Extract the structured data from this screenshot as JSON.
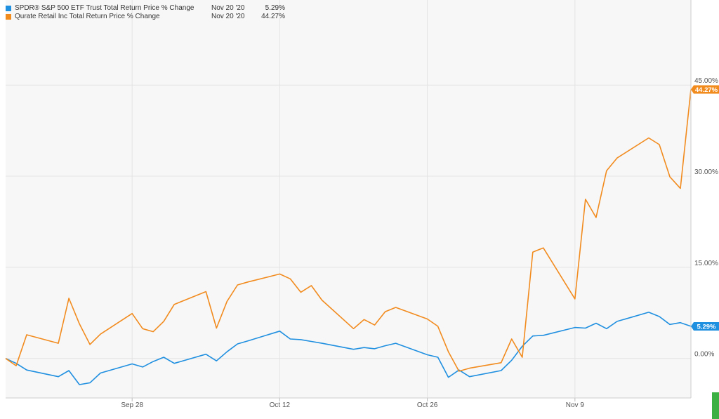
{
  "legend": [
    {
      "name": "SPDR® S&P 500 ETF Trust Total Return Price % Change",
      "date": "Nov 20 '20",
      "value": "5.29%",
      "color": "#1f8fe0"
    },
    {
      "name": "Qurate Retail Inc Total Return Price % Change",
      "date": "Nov 20 '20",
      "value": "44.27%",
      "color": "#f28b1e"
    }
  ],
  "colors": {
    "plot_background": "#f7f7f7",
    "grid": "#e4e4e4",
    "axis_text": "#555555",
    "accent_green": "#3cb043"
  },
  "chart_data": {
    "type": "line",
    "title": "",
    "xlabel": "",
    "ylabel": "",
    "ylim": [
      -6.5,
      59
    ],
    "x_ticks": [
      {
        "label": "Sep 28",
        "date": "2020-09-28"
      },
      {
        "label": "Oct 12",
        "date": "2020-10-12"
      },
      {
        "label": "Oct 26",
        "date": "2020-10-26"
      },
      {
        "label": "Nov 9",
        "date": "2020-11-09"
      }
    ],
    "y_ticks": [
      {
        "value": 0,
        "label": "0.00%"
      },
      {
        "value": 15,
        "label": "15.00%"
      },
      {
        "value": 30,
        "label": "30.00%"
      },
      {
        "value": 45,
        "label": "45.00%"
      }
    ],
    "grid": true,
    "legend_position": "top-left",
    "end_labels": [
      {
        "series": "SPDR® S&P 500 ETF Trust Total Return Price % Change",
        "label": "5.29%",
        "value": 5.29
      },
      {
        "series": "Qurate Retail Inc Total Return Price % Change",
        "label": "44.27%",
        "value": 44.27
      }
    ],
    "x": [
      "2020-09-16",
      "2020-09-17",
      "2020-09-18",
      "2020-09-21",
      "2020-09-22",
      "2020-09-23",
      "2020-09-24",
      "2020-09-25",
      "2020-09-28",
      "2020-09-29",
      "2020-09-30",
      "2020-10-01",
      "2020-10-02",
      "2020-10-05",
      "2020-10-06",
      "2020-10-07",
      "2020-10-08",
      "2020-10-09",
      "2020-10-12",
      "2020-10-13",
      "2020-10-14",
      "2020-10-15",
      "2020-10-16",
      "2020-10-19",
      "2020-10-20",
      "2020-10-21",
      "2020-10-22",
      "2020-10-23",
      "2020-10-26",
      "2020-10-27",
      "2020-10-28",
      "2020-10-29",
      "2020-10-30",
      "2020-11-02",
      "2020-11-03",
      "2020-11-04",
      "2020-11-05",
      "2020-11-06",
      "2020-11-09",
      "2020-11-10",
      "2020-11-11",
      "2020-11-12",
      "2020-11-13",
      "2020-11-16",
      "2020-11-17",
      "2020-11-18",
      "2020-11-19",
      "2020-11-20"
    ],
    "series": [
      {
        "name": "SPDR® S&P 500 ETF Trust Total Return Price % Change",
        "color": "#1f8fe0",
        "values": [
          0.0,
          -0.8,
          -1.9,
          -3.0,
          -2.0,
          -4.3,
          -4.0,
          -2.4,
          -0.9,
          -1.4,
          -0.5,
          0.2,
          -0.8,
          0.7,
          -0.4,
          1.1,
          2.4,
          2.9,
          4.5,
          3.2,
          3.1,
          2.8,
          2.5,
          1.5,
          1.8,
          1.6,
          2.1,
          2.5,
          0.6,
          0.2,
          -3.1,
          -1.9,
          -3.0,
          -2.0,
          -0.3,
          2.0,
          3.7,
          3.8,
          5.1,
          5.0,
          5.8,
          4.9,
          6.1,
          7.6,
          6.9,
          5.6,
          5.9,
          5.29
        ]
      },
      {
        "name": "Qurate Retail Inc Total Return Price % Change",
        "color": "#f28b1e",
        "values": [
          0.0,
          -1.2,
          3.9,
          2.5,
          9.9,
          5.7,
          2.3,
          4.0,
          7.4,
          4.9,
          4.4,
          6.1,
          8.9,
          11.0,
          5.0,
          9.4,
          12.1,
          12.6,
          13.9,
          13.1,
          10.9,
          12.0,
          9.6,
          4.9,
          6.4,
          5.5,
          7.7,
          8.4,
          6.5,
          5.3,
          1.1,
          -2.1,
          -1.6,
          -0.7,
          3.2,
          0.2,
          17.5,
          18.2,
          9.8,
          26.2,
          23.2,
          30.9,
          33.0,
          36.3,
          35.2,
          29.9,
          28.0,
          44.27
        ]
      }
    ]
  }
}
